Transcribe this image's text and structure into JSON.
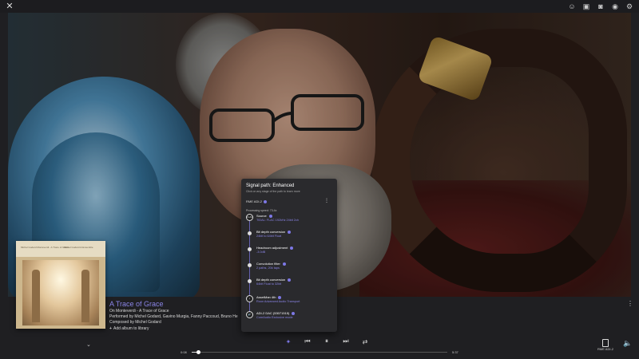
{
  "topbar": {
    "close_icon": "close-icon",
    "icons": [
      "profile-icon",
      "zone-icon",
      "album-icon",
      "radio-icon",
      "settings-icon"
    ]
  },
  "track": {
    "title": "A Trace of Grace",
    "lines": [
      "On Monteverdi - A Trace of Grace",
      "Performed by Michel Godard, Gavino Murgia, Fanny Paccoud, Bruno He",
      "Composed by Michel Godard"
    ],
    "add_label": "Add album to library"
  },
  "album_art": {
    "text_left": "Michel Godard\nMonteverdi - A Trace of Grace",
    "text_right": "Michel Godard & Ensemble"
  },
  "playback": {
    "current_time": "0:08",
    "total_time": "5:37",
    "progress_fraction": 0.024
  },
  "zone": {
    "label": "RME ADI-2"
  },
  "signal_path": {
    "title": "Signal path: Enhanced",
    "subtitle": "Click on any stage of the path to learn more",
    "device": "RME ADI-2",
    "processing_speed": "Processing speed: 73.4x",
    "steps": [
      {
        "name": "Source",
        "detail": "TIDAL: FLAC 192kHz 24bit 2ch",
        "icon": "FLAC"
      },
      {
        "name": "Bit depth conversion",
        "detail": "24bit to 64bit Float",
        "icon": ""
      },
      {
        "name": "Headroom adjustment",
        "detail": "-3.0dB",
        "icon": ""
      },
      {
        "name": "Convolution filter",
        "detail": "2 paths, 20k taps",
        "icon": ""
      },
      {
        "name": "Bit depth conversion",
        "detail": "64bit Float to 32bit",
        "icon": ""
      },
      {
        "name": "AssetMan 4th",
        "detail": "Roon Advanced Audio Transport",
        "icon": ""
      },
      {
        "name": "ADI-2 DAC (53071515)",
        "detail": "CoreAudio Exclusive mode",
        "icon": ""
      }
    ]
  },
  "colors": {
    "accent": "#7d78e6",
    "background": "#1f1f22"
  }
}
